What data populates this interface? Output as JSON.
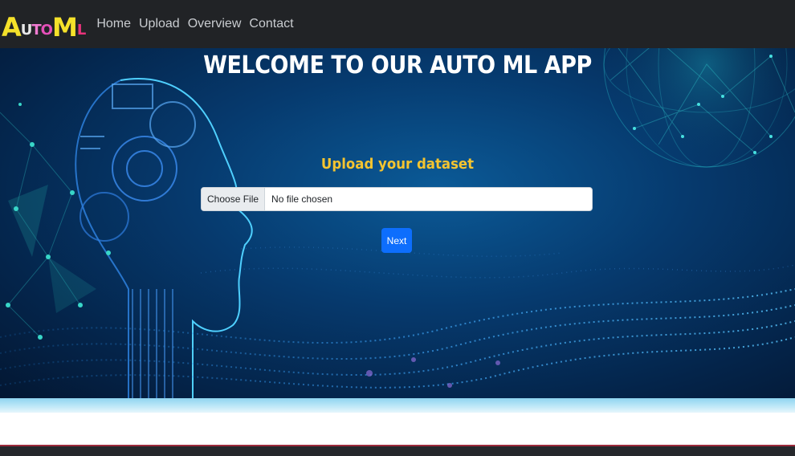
{
  "navbar": {
    "logo": [
      {
        "char": "A",
        "color": "#f5e12a",
        "size": "big"
      },
      {
        "char": "U",
        "color": "#e8e8e8",
        "size": "small"
      },
      {
        "char": "T",
        "color": "#f07ad0",
        "size": "small"
      },
      {
        "char": "O",
        "color": "#e54fb8",
        "size": "small"
      },
      {
        "char": "M",
        "color": "#f5e12a",
        "size": "big"
      },
      {
        "char": "L",
        "color": "#e8337a",
        "size": "small"
      }
    ],
    "links": [
      "Home",
      "Upload",
      "Overview",
      "Contact"
    ]
  },
  "hero": {
    "title": "WELCOME TO OUR AUTO ML APP",
    "subtitle": "Upload your dataset",
    "file_button_label": "Choose File",
    "file_status": "No file chosen",
    "next_label": "Next"
  },
  "colors": {
    "navbar_bg": "#212326",
    "subtitle": "#f4c430",
    "primary_button": "#0d6efd",
    "footer_accent": "#9c2a3b"
  }
}
